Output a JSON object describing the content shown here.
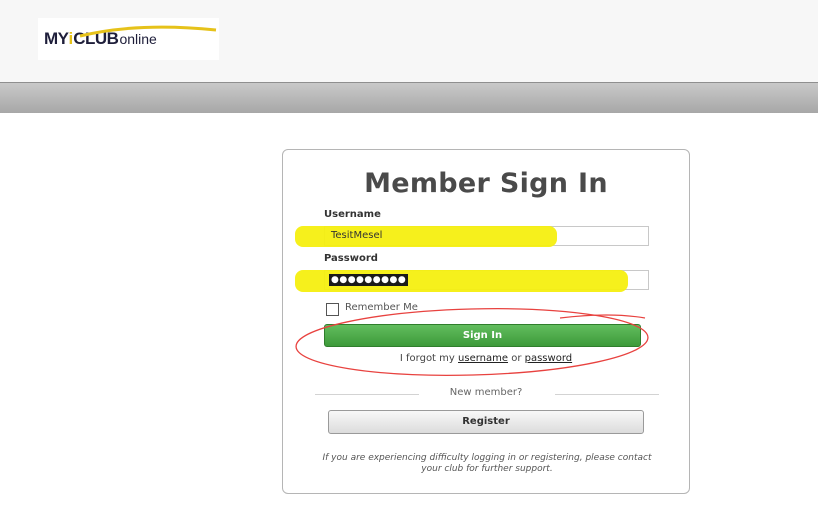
{
  "logo": {
    "part1": "MY",
    "part2": "i",
    "part3": "CLUB",
    "part4": "online"
  },
  "card": {
    "title": "Member Sign In",
    "username": {
      "label": "Username",
      "value": "TesitMesel"
    },
    "password": {
      "label": "Password",
      "masked": "●●●●●●●●●"
    },
    "remember_label": "Remember Me",
    "signin_label": "Sign In",
    "forgot": {
      "prefix": "I forgot my",
      "username_link": "username",
      "middle": "or",
      "password_link": "password"
    },
    "new_member_label": "New member?",
    "register_label": "Register",
    "help_text": "If you are experiencing difficulty logging in or registering, please contact your club for further support."
  },
  "colors": {
    "highlight": "#f6ef10",
    "annotation": "#e8423f",
    "signin_green": "#4aa846",
    "logo_yellow": "#e6c21a"
  }
}
